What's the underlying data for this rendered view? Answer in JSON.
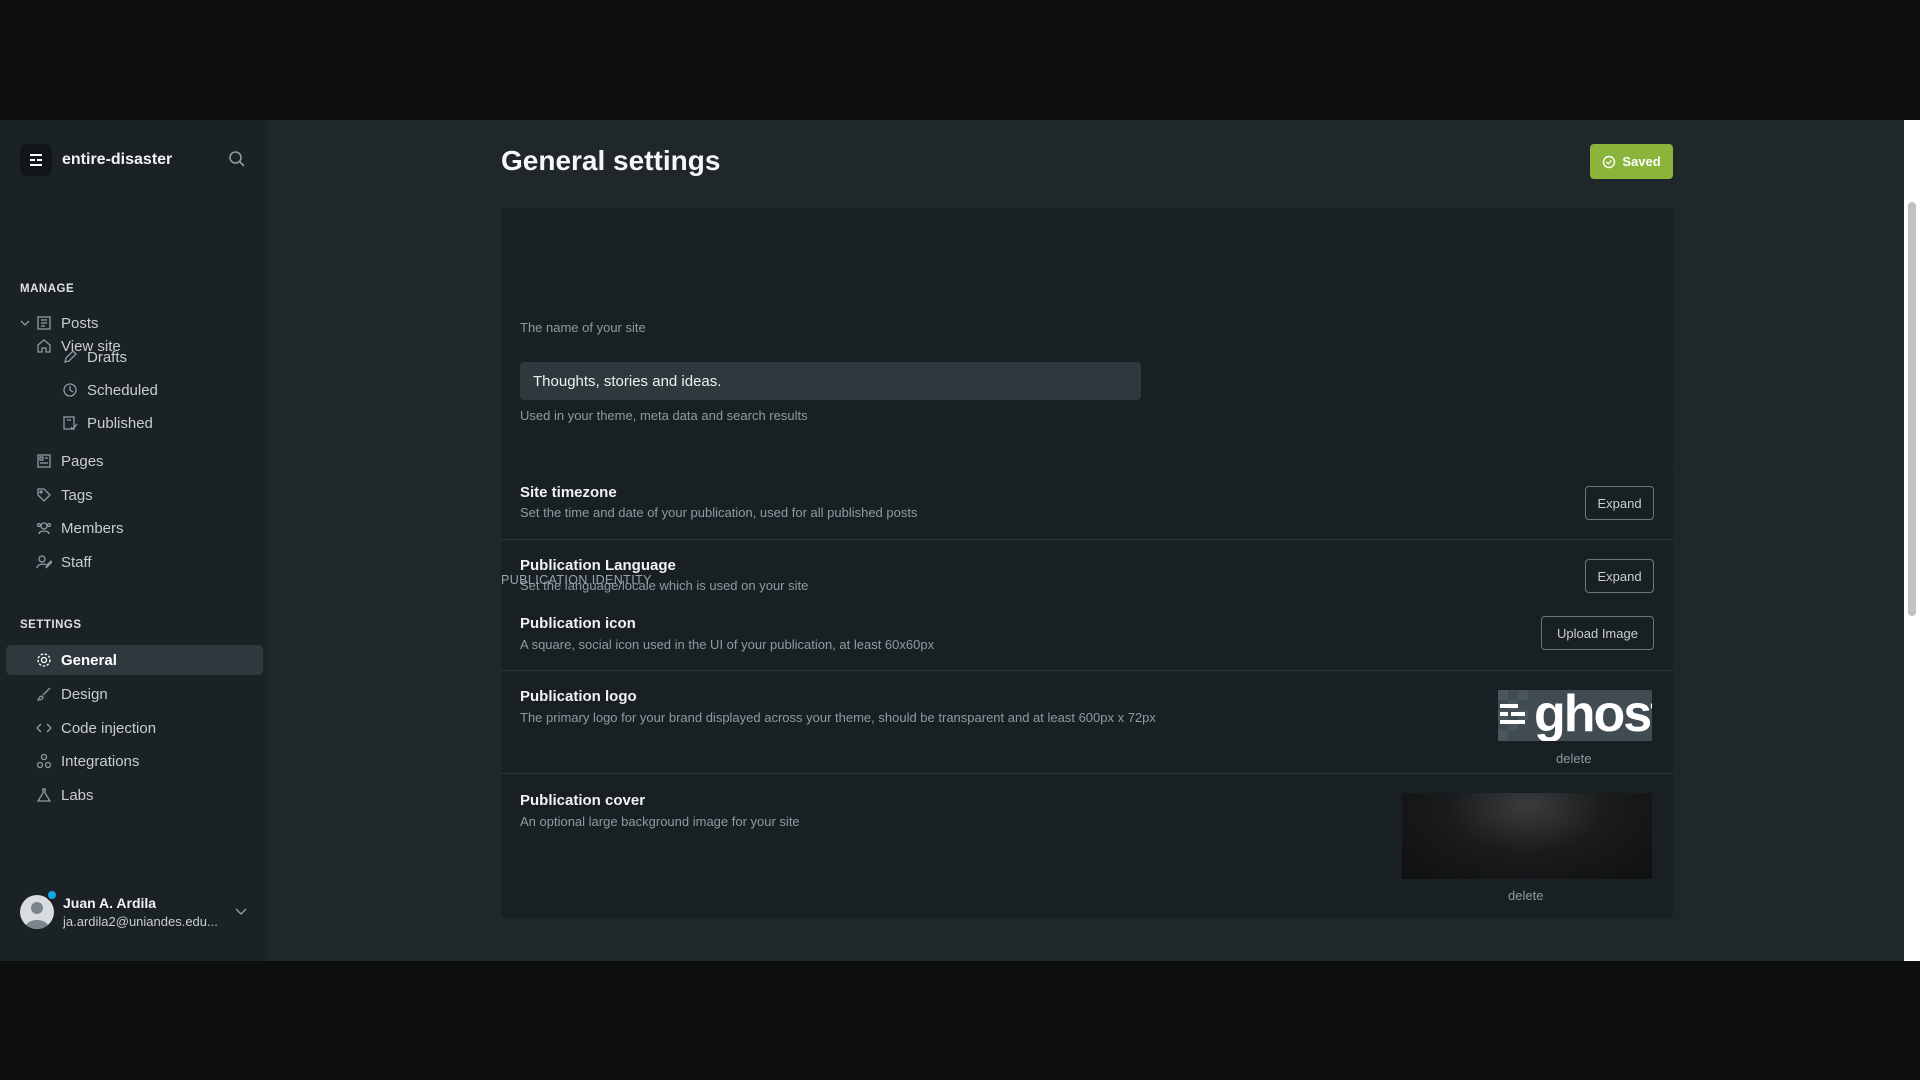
{
  "sidebar": {
    "site_name": "entire-disaster",
    "view_site": "View site",
    "manage_title": "MANAGE",
    "settings_title": "SETTINGS",
    "manage_items": [
      {
        "label": "Posts",
        "icon": "posts-icon"
      },
      {
        "label": "Drafts",
        "icon": "pencil-icon"
      },
      {
        "label": "Scheduled",
        "icon": "clock-icon"
      },
      {
        "label": "Published",
        "icon": "published-icon"
      },
      {
        "label": "Pages",
        "icon": "pages-icon"
      },
      {
        "label": "Tags",
        "icon": "tag-icon"
      },
      {
        "label": "Members",
        "icon": "members-icon"
      },
      {
        "label": "Staff",
        "icon": "staff-icon"
      }
    ],
    "settings_items": [
      {
        "label": "General",
        "icon": "gear-icon",
        "active": true
      },
      {
        "label": "Design",
        "icon": "brush-icon"
      },
      {
        "label": "Code injection",
        "icon": "code-icon"
      },
      {
        "label": "Integrations",
        "icon": "integrations-icon"
      },
      {
        "label": "Labs",
        "icon": "flask-icon"
      }
    ],
    "user": {
      "name": "Juan A. Ardila",
      "email": "ja.ardila2@uniandes.edu..."
    }
  },
  "header": {
    "title": "General settings",
    "saved_label": "Saved"
  },
  "card1": {
    "title_desc": "The name of your site",
    "description_value": "Thoughts, stories and ideas.",
    "description_help": "Used in your theme, meta data and search results",
    "timezone_title": "Site timezone",
    "timezone_desc": "Set the time and date of your publication, used for all published posts",
    "language_title": "Publication Language",
    "language_desc": "Set the language/locale which is used on your site",
    "expand_label": "Expand"
  },
  "identity": {
    "section_title": "PUBLICATION IDENTITY",
    "icon_title": "Publication icon",
    "icon_desc": "A square, social icon used in the UI of your publication, at least 60x60px",
    "upload_label": "Upload Image",
    "logo_title": "Publication logo",
    "logo_desc": "The primary logo for your brand displayed across your theme, should be transparent and at least 600px x 72px",
    "logo_text": "ghost",
    "cover_title": "Publication cover",
    "cover_desc": "An optional large background image for your site",
    "delete_label": "delete"
  },
  "colors": {
    "accent": "#8ab43a",
    "background": "#1f272b",
    "sidebar": "#1b2226",
    "card": "#192024"
  }
}
